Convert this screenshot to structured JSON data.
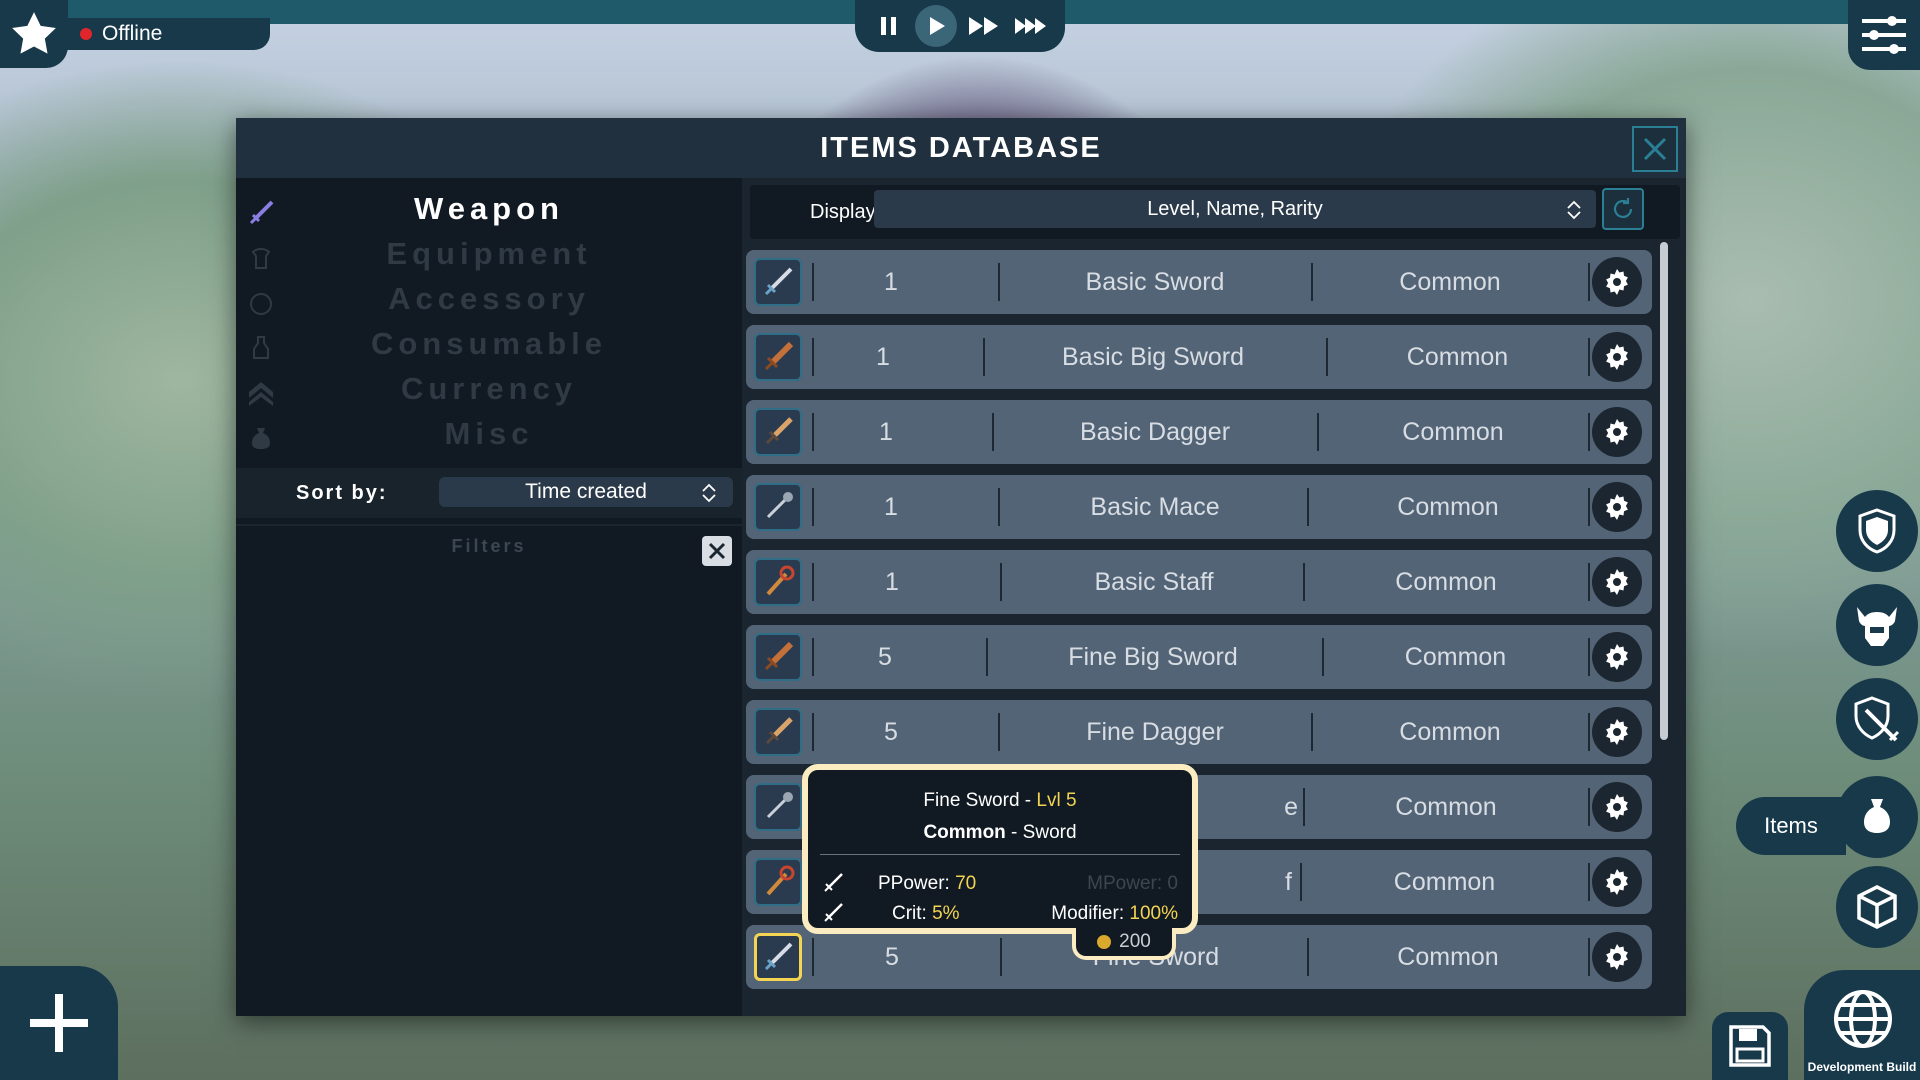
{
  "status": {
    "label": "Offline",
    "color": "#e0262b"
  },
  "playback": {
    "pause_icon": "pause-icon",
    "play_icon": "play-icon",
    "fast_icon": "fast-forward-icon",
    "faster_icon": "fastest-forward-icon"
  },
  "panel": {
    "title": "ITEMS DATABASE"
  },
  "categories": [
    {
      "label": "Weapon",
      "icon": "sword-icon",
      "active": true
    },
    {
      "label": "Equipment",
      "icon": "armor-icon",
      "active": false
    },
    {
      "label": "Accessory",
      "icon": "ring-icon",
      "active": false
    },
    {
      "label": "Consumable",
      "icon": "potion-icon",
      "active": false
    },
    {
      "label": "Currency",
      "icon": "chevrons-icon",
      "active": false
    },
    {
      "label": "Misc",
      "icon": "bag-icon",
      "active": false
    }
  ],
  "sort": {
    "label": "Sort by:",
    "value": "Time created"
  },
  "filters": {
    "label": "Filters"
  },
  "display": {
    "label": "Display:",
    "value": "Level, Name, Rarity"
  },
  "items": [
    {
      "level": "1",
      "name": "Basic Sword",
      "rarity": "Common",
      "icon": "sword-icon"
    },
    {
      "level": "1",
      "name": "Basic Big Sword",
      "rarity": "Common",
      "icon": "big-sword-icon"
    },
    {
      "level": "1",
      "name": "Basic Dagger",
      "rarity": "Common",
      "icon": "dagger-icon"
    },
    {
      "level": "1",
      "name": "Basic Mace",
      "rarity": "Common",
      "icon": "mace-icon"
    },
    {
      "level": "1",
      "name": "Basic Staff",
      "rarity": "Common",
      "icon": "staff-icon"
    },
    {
      "level": "5",
      "name": "Fine Big Sword",
      "rarity": "Common",
      "icon": "big-sword-icon"
    },
    {
      "level": "5",
      "name": "Fine Dagger",
      "rarity": "Common",
      "icon": "dagger-icon"
    },
    {
      "level": "",
      "name": "e",
      "rarity": "Common",
      "icon": "mace-icon"
    },
    {
      "level": "",
      "name": "f",
      "rarity": "Common",
      "icon": "staff-icon"
    },
    {
      "level": "5",
      "name": "Fine Sword",
      "rarity": "Common",
      "icon": "sword-icon"
    }
  ],
  "tooltip": {
    "name": "Fine Sword",
    "sep": " - ",
    "level": "Lvl 5",
    "rarity": "Common",
    "type": "Sword",
    "ppower_label": "PPower:",
    "ppower": "70",
    "mpower_label": "MPower:",
    "mpower": "0",
    "crit_label": "Crit:",
    "crit": "5%",
    "modifier_label": "Modifier:",
    "modifier": "100%",
    "price": "200"
  },
  "side_menu": {
    "items_label": "Items",
    "icons": [
      "shield-icon",
      "helmet-icon",
      "shield-sword-icon",
      "bag-icon",
      "cube-icon"
    ]
  },
  "dev": {
    "label": "Development Build"
  }
}
